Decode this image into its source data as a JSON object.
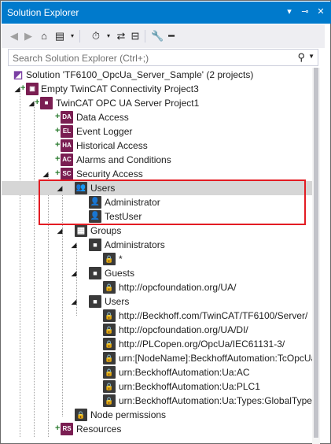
{
  "window": {
    "title": "Solution Explorer"
  },
  "titlebar_icons": [
    "pin-icon",
    "close-icon",
    "dropdown-icon"
  ],
  "search": {
    "placeholder": "Search Solution Explorer (Ctrl+;)"
  },
  "tree": [
    {
      "label": "Solution 'TF6100_OpcUa_Server_Sample' (2 projects)",
      "icon": "solution-icon",
      "level": 0
    },
    {
      "label": "Empty TwinCAT Connectivity Project3",
      "icon": "connectivity-project-icon",
      "level": 1
    },
    {
      "label": "TwinCAT OPC UA Server Project1",
      "icon": "opcua-project-icon",
      "level": 2
    },
    {
      "label": "Data Access",
      "icon": "DA",
      "level": 3
    },
    {
      "label": "Event Logger",
      "icon": "EL",
      "level": 3
    },
    {
      "label": "Historical Access",
      "icon": "HA",
      "level": 3
    },
    {
      "label": "Alarms and Conditions",
      "icon": "AC",
      "level": 3
    },
    {
      "label": "Security Access",
      "icon": "SC",
      "level": 3
    },
    {
      "label": "Users",
      "icon": "users-icon",
      "level": 4
    },
    {
      "label": "Administrator",
      "icon": "user-icon",
      "level": 5
    },
    {
      "label": "TestUser",
      "icon": "user-icon",
      "level": 5
    },
    {
      "label": "Groups",
      "icon": "groups-icon",
      "level": 4
    },
    {
      "label": "Administrators",
      "icon": "group-icon",
      "level": 5
    },
    {
      "label": "*",
      "icon": "lock-icon",
      "level": 6
    },
    {
      "label": "Guests",
      "icon": "group-icon",
      "level": 5
    },
    {
      "label": "http://opcfoundation.org/UA/",
      "icon": "lock-icon",
      "level": 6
    },
    {
      "label": "Users",
      "icon": "group-icon",
      "level": 5
    },
    {
      "label": "http://Beckhoff.com/TwinCAT/TF6100/Server/",
      "icon": "lock-icon",
      "level": 6
    },
    {
      "label": "http://opcfoundation.org/UA/DI/",
      "icon": "lock-icon",
      "level": 6
    },
    {
      "label": "http://PLCopen.org/OpcUa/IEC61131-3/",
      "icon": "lock-icon",
      "level": 6
    },
    {
      "label": "urn:[NodeName]:BeckhoffAutomation:TcOpcUaServer",
      "icon": "lock-icon",
      "level": 6
    },
    {
      "label": "urn:BeckhoffAutomation:Ua:AC",
      "icon": "lock-icon",
      "level": 6
    },
    {
      "label": "urn:BeckhoffAutomation:Ua:PLC1",
      "icon": "lock-icon",
      "level": 6
    },
    {
      "label": "urn:BeckhoffAutomation:Ua:Types:GlobalType",
      "icon": "lock-icon",
      "level": 6
    },
    {
      "label": "Node permissions",
      "icon": "lock-icon",
      "level": 4
    },
    {
      "label": "Resources",
      "icon": "RS",
      "level": 3
    }
  ],
  "colors": {
    "titlebar": "#007acc",
    "highlight": "#e31c23",
    "selection": "#d6d6d6",
    "twincat_icon": "#7a1e52"
  }
}
